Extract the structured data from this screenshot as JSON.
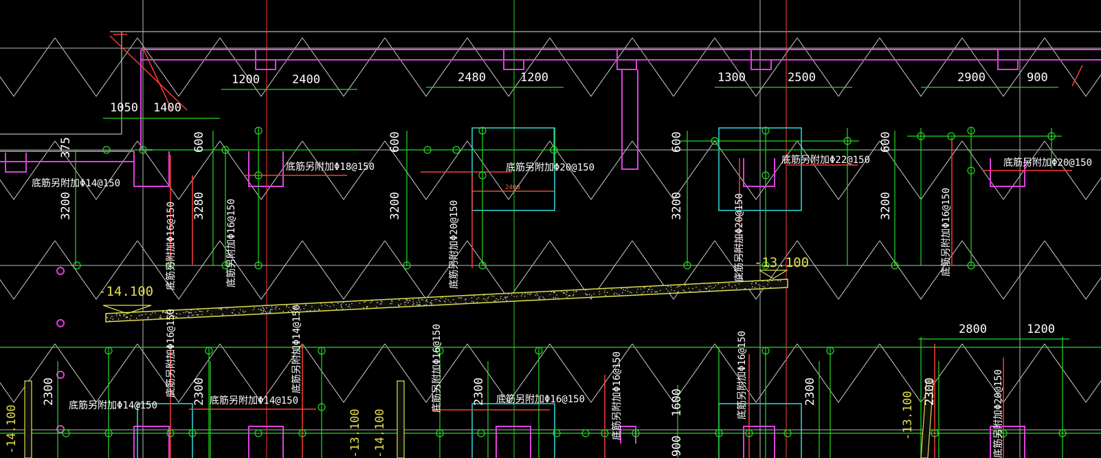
{
  "colors": {
    "background": "#000000",
    "grid_white": "#d8d8d8",
    "grid_green": "#22dd22",
    "grid_red": "#ff3b3b",
    "magenta": "#e040e0",
    "cyan": "#33dddd",
    "yellow": "#e0e050",
    "label_white": "#ffffff"
  },
  "dimensions_top": [
    "1200",
    "2400",
    "2480",
    "1200",
    "1300",
    "2500",
    "2900",
    "900",
    "1050",
    "1400"
  ],
  "dimensions_vertical": [
    "375",
    "600",
    "3200",
    "3280",
    "600",
    "3200",
    "600",
    "3200",
    "600",
    "3200"
  ],
  "dimensions_bottom": [
    "2800",
    "1200",
    "2300",
    "2300",
    "2300",
    "2300",
    "2300",
    "1600",
    "900"
  ],
  "inner_dimension": "2400",
  "elevations": [
    "-14.100",
    "-13.100",
    "-14.100",
    "-13.100",
    "-14.100",
    "-13.100"
  ],
  "rebar_notes": [
    "底筋另附加Φ14@150",
    "底筋另附加Φ18@150",
    "底筋另附加Φ20@150",
    "底筋另附加Φ22@150",
    "底筋另附加Φ20@150",
    "底筋另附加Φ16@150",
    "底筋另附加Φ16@150",
    "底筋另附加Φ20@150",
    "底筋另附加Φ20@150",
    "底筋另附加Φ16@150",
    "底筋另附加Φ16@150",
    "底筋另附加Φ14@150",
    "底筋另附加Φ14@150",
    "底筋另附加Φ14@150",
    "底筋另附加Φ16@150",
    "底筋另附加Φ16@150",
    "底筋另附加Φ16@150",
    "底筋另附加Φ16@150",
    "底筋另附加Φ20@150"
  ]
}
